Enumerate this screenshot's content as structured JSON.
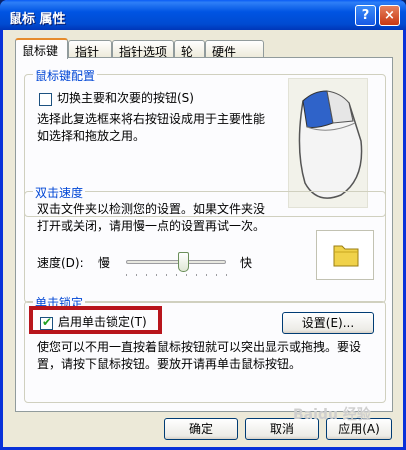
{
  "window": {
    "title": "鼠标 属性",
    "help_glyph": "?",
    "close_glyph": "×"
  },
  "tabs": [
    "鼠标键",
    "指针",
    "指针选项",
    "轮",
    "硬件"
  ],
  "button_config": {
    "title": "鼠标键配置",
    "checkbox_label": "切换主要和次要的按钮(S)",
    "checkbox_checked": false,
    "desc_line1": "选择此复选框来将右按钮设成用于主要性能",
    "desc_line2": "如选择和拖放之用。"
  },
  "double_click": {
    "title": "双击速度",
    "desc_line1": "双击文件夹以检测您的设置。如果文件夹没",
    "desc_line2": "打开或关闭，请用慢一点的设置再试一次。",
    "speed_label": "速度(D):",
    "slow_label": "慢",
    "fast_label": "快",
    "speed_fraction": 0.57,
    "tick_count": 11
  },
  "click_lock": {
    "title": "单击锁定",
    "checkbox_label": "启用单击锁定(T)",
    "checkbox_checked": true,
    "settings_label": "设置(E)...",
    "desc_line1": "使您可以不用一直按着鼠标按钮就可以突出显示或拖拽。要设",
    "desc_line2": "置，请按下鼠标按钮。要放开请再单击鼠标按钮。"
  },
  "footer": {
    "ok_label": "确定",
    "cancel_label": "取消",
    "apply_label": "应用(A)"
  },
  "watermark": "Baidu 经验",
  "colors": {
    "title_blue": "#0054e3",
    "group_title": "#0046d5",
    "highlight": "#b8151c",
    "folder": "#f0d24a"
  }
}
